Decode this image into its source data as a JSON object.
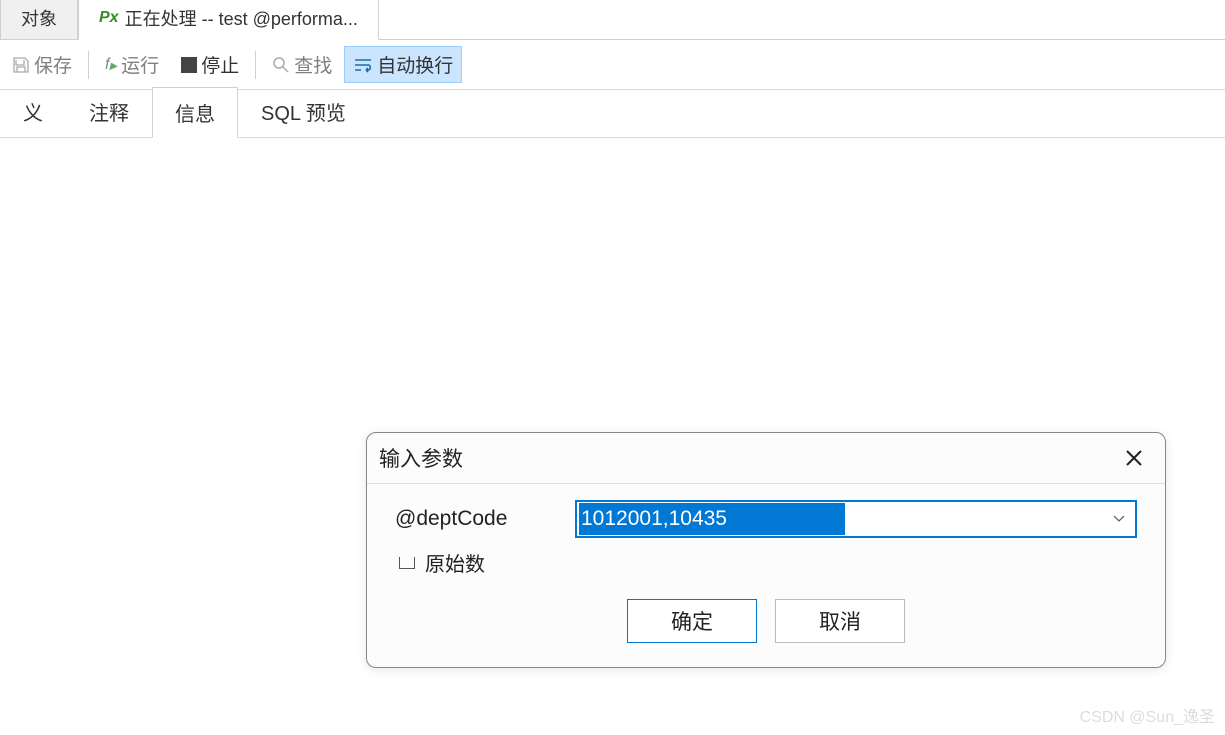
{
  "topTabs": {
    "object": "对象",
    "active": "正在处理 -- test @performa..."
  },
  "toolbar": {
    "save": "保存",
    "run": "运行",
    "stop": "停止",
    "find": "查找",
    "autowrap": "自动换行"
  },
  "subTabs": {
    "definition": "义",
    "comment": "注释",
    "info": "信息",
    "sqlpreview": "SQL 预览"
  },
  "dialog": {
    "title": "输入参数",
    "param_label": "@deptCode",
    "param_value": "1012001,10435",
    "checkbox_label": "原始数",
    "ok": "确定",
    "cancel": "取消"
  },
  "watermark": "CSDN @Sun_逸圣"
}
